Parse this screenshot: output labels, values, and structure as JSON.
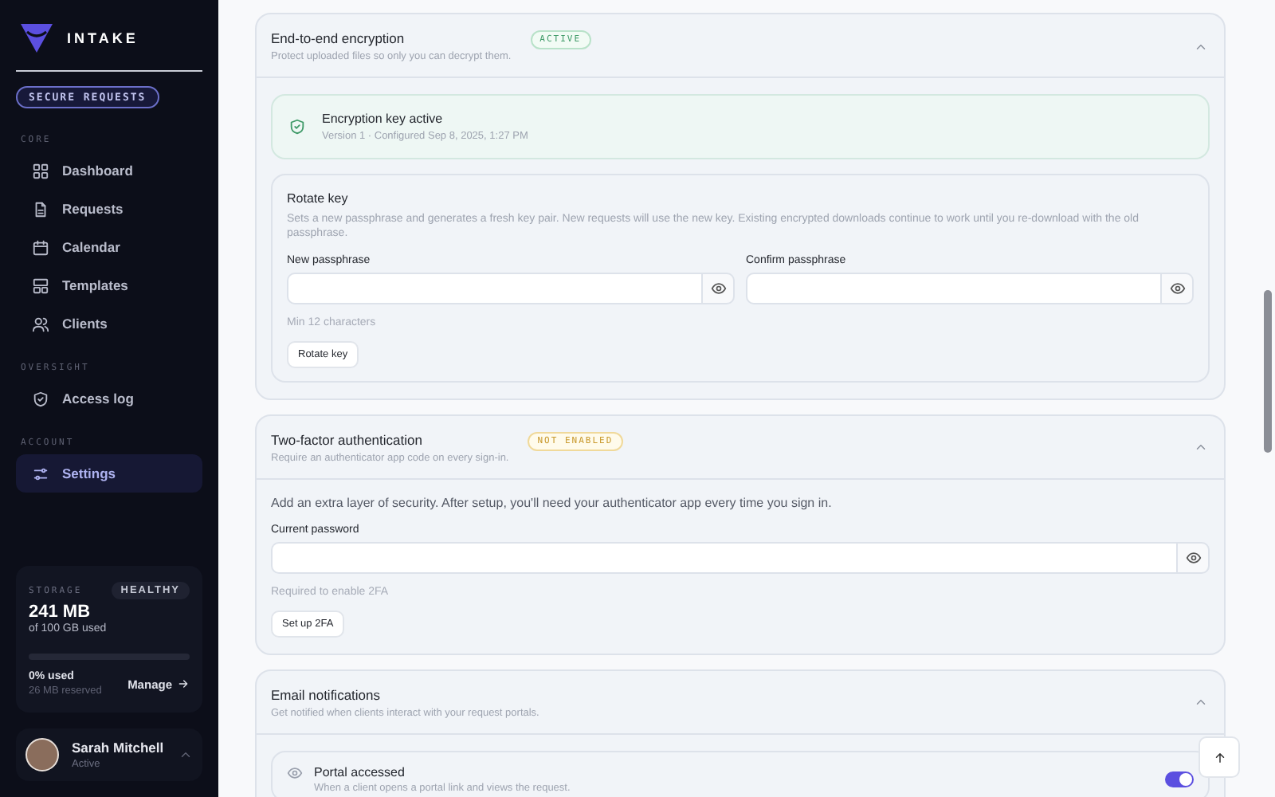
{
  "sidebar": {
    "logo": "INTAKE",
    "badge": "SECURE REQUESTS",
    "groups": [
      {
        "heading": "CORE",
        "items": [
          {
            "label": "Dashboard",
            "selected": false
          },
          {
            "label": "Requests",
            "selected": false
          },
          {
            "label": "Calendar",
            "selected": false
          },
          {
            "label": "Templates",
            "selected": false
          },
          {
            "label": "Clients",
            "selected": false
          }
        ]
      },
      {
        "heading": "OVERSIGHT",
        "items": [
          {
            "label": "Access log",
            "selected": false
          }
        ]
      },
      {
        "heading": "ACCOUNT",
        "items": [
          {
            "label": "Settings",
            "selected": true
          }
        ]
      }
    ],
    "storage": {
      "heading": "STORAGE",
      "status": "HEALTHY",
      "amount": "241 MB",
      "total": "of 100 GB used",
      "level": 0,
      "used": "0% used",
      "reserved": "26 MB reserved",
      "manage": "Manage"
    },
    "user": {
      "name": "Sarah Mitchell",
      "status": "Active"
    }
  },
  "sections": [
    {
      "kind": "encryption",
      "title": "End-to-end encryption",
      "subtitle": "Protect uploaded files so only you can decrypt them.",
      "badge": {
        "text": "ACTIVE",
        "kind": "success"
      },
      "expanded": true,
      "status": {
        "title": "Encryption key active",
        "detail": "Version 1 · Configured Sep 8, 2025, 1:27 PM"
      },
      "rotate": {
        "title": "Rotate key",
        "description": "Sets a new passphrase and generates a fresh key pair. New requests will use the new key. Existing encrypted downloads continue to work until you re-download with the old passphrase.",
        "fields": [
          {
            "label": "New passphrase"
          },
          {
            "label": "Confirm passphrase"
          }
        ],
        "hint": "Min 12 characters",
        "button": "Rotate key"
      }
    },
    {
      "kind": "twofactor",
      "title": "Two-factor authentication",
      "subtitle": "Require an authenticator app code on every sign-in.",
      "badge": {
        "text": "NOT ENABLED",
        "kind": "warning"
      },
      "expanded": true,
      "intro": "Add an extra layer of security. After setup, you'll need your authenticator app every time you sign in.",
      "field": {
        "label": "Current password"
      },
      "hint": "Required to enable 2FA",
      "button": "Set up 2FA"
    },
    {
      "kind": "notifications",
      "title": "Email notifications",
      "subtitle": "Get notified when clients interact with your request portals.",
      "expanded": true,
      "items": [
        {
          "title": "Portal accessed",
          "description": "When a client opens a portal link and views the request.",
          "on": true
        }
      ]
    }
  ]
}
